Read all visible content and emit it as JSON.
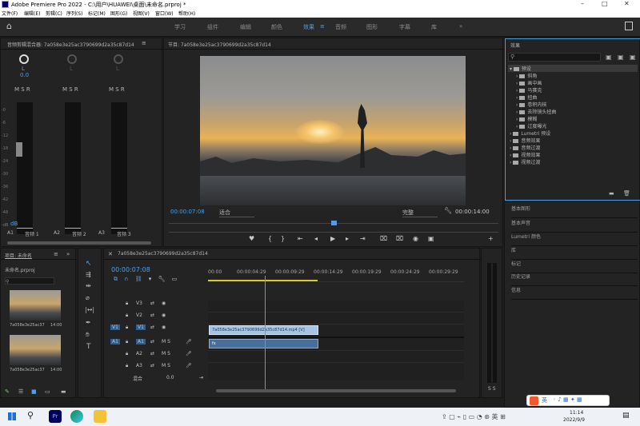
{
  "app": {
    "title": "Adobe Premiere Pro 2022 - C:\\用户\\HUAWEI\\桌面\\未命名.prproj *"
  },
  "menu": [
    "文件(F)",
    "编辑(E)",
    "剪辑(C)",
    "序列(S)",
    "标记(M)",
    "图形(G)",
    "视图(V)",
    "窗口(W)",
    "帮助(H)"
  ],
  "workspaces": [
    {
      "label": "学习",
      "active": false
    },
    {
      "label": "组件",
      "active": false
    },
    {
      "label": "编辑",
      "active": false
    },
    {
      "label": "颜色",
      "active": false
    },
    {
      "label": "效果",
      "active": true
    },
    {
      "label": "音频",
      "active": false
    },
    {
      "label": "图形",
      "active": false
    },
    {
      "label": "字幕",
      "active": false
    },
    {
      "label": "库",
      "active": false
    }
  ],
  "audio_mixer": {
    "title": "音频剪辑混合器: 7a058e3e25ac3790699d2a35c87d14",
    "channels": [
      {
        "lr": "L",
        "value": "0.0"
      },
      {
        "lr": "L",
        "value": ""
      },
      {
        "lr": "L",
        "value": ""
      }
    ],
    "msr": "M S R",
    "db_scale": [
      "-0",
      "-6",
      "-12",
      "-18",
      "-24",
      "-30",
      "-36",
      "-42",
      "-48",
      "-dB"
    ],
    "footer": [
      "A1",
      "音频 1",
      "A2",
      "音频 2",
      "A3",
      "音频 3"
    ],
    "side_label": "dB"
  },
  "program_monitor": {
    "title": "节目: 7a058e3e25ac3790699d2a35c87d14",
    "timecode": "00:00:07:08",
    "fit": "适合",
    "quality": "完整",
    "duration": "00:00:14:00",
    "progress": 0.5
  },
  "project": {
    "title": "项目: 未命名",
    "file": "未命名.prproj",
    "items": [
      {
        "name": "7a058e3e25ac37",
        "duration": "14:00"
      },
      {
        "name": "7a058e3e25ac37",
        "duration": "14:00"
      }
    ]
  },
  "timeline": {
    "title": "7a058e3e25ac3790699d2a35c87d14",
    "timecode": "00:00:07:08",
    "ruler": [
      "00:00",
      "00:00:04:29",
      "00:00:09:29",
      "00:00:14:29",
      "00:00:19:29",
      "00:00:24:29",
      "00:00:29:29"
    ],
    "video_tracks": [
      "V3",
      "V2",
      "V1"
    ],
    "audio_tracks": [
      "A1",
      "A2",
      "A3"
    ],
    "source_v": "V1",
    "source_a": "A1",
    "mix_label": "混合",
    "mix_value": "0.0",
    "clip_label": "7a058e3e25ac3790699d2a35c87d14.mp4 [V]",
    "audio_clip_label": "fx",
    "msbuttons": "M S",
    "playhead_fraction": 0.5
  },
  "effects": {
    "title": "效果",
    "tree": [
      {
        "label": "预设",
        "level": 0,
        "selected": true
      },
      {
        "label": "斜角",
        "level": 1
      },
      {
        "label": "画中画",
        "level": 1
      },
      {
        "label": "马赛克",
        "level": 1
      },
      {
        "label": "扭曲",
        "level": 1
      },
      {
        "label": "卷积内核",
        "level": 1
      },
      {
        "label": "去除镜头扭曲",
        "level": 1
      },
      {
        "label": "模糊",
        "level": 1
      },
      {
        "label": "过度曝光",
        "level": 1
      },
      {
        "label": "Lumetri 预设",
        "level": 0
      },
      {
        "label": "音频效果",
        "level": 0
      },
      {
        "label": "音频过渡",
        "level": 0
      },
      {
        "label": "视频效果",
        "level": 0
      },
      {
        "label": "视频过渡",
        "level": 0
      }
    ],
    "sections": [
      "基本图形",
      "基本声音",
      "Lumetri 颜色",
      "库",
      "标记",
      "历史记录",
      "信息"
    ]
  },
  "taskbar": {
    "time": "11:14",
    "date": "2022/9/9",
    "ime": "英"
  }
}
